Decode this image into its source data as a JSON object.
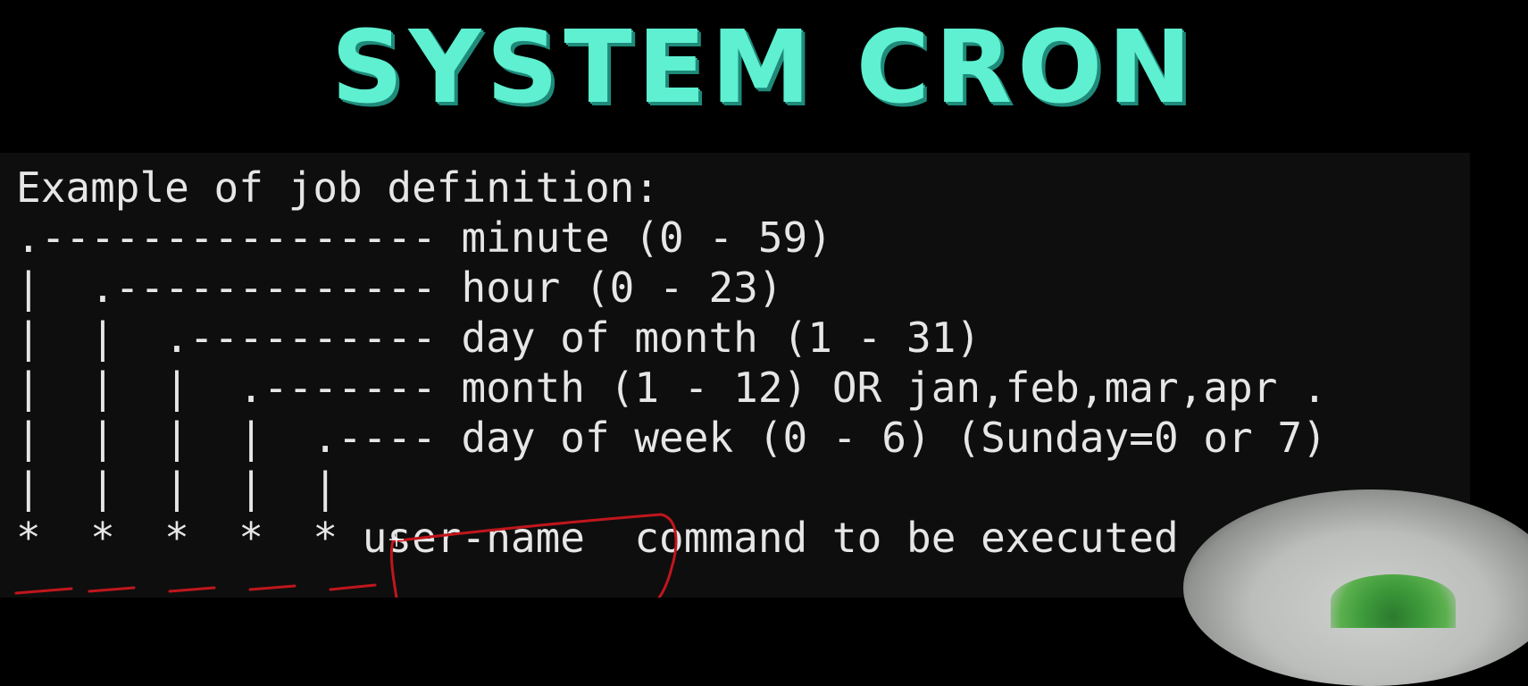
{
  "title": "SYSTEM CRON",
  "terminal": {
    "lines": [
      "Example of job definition:",
      ".---------------- minute (0 - 59)",
      "|  .------------- hour (0 - 23)",
      "|  |  .---------- day of month (1 - 31)",
      "|  |  |  .------- month (1 - 12) OR jan,feb,mar,apr .",
      "|  |  |  |  .---- day of week (0 - 6) (Sunday=0 or 7)",
      "|  |  |  |  |",
      "*  *  *  *  * user-name  command to be executed"
    ]
  },
  "colors": {
    "title": "#5ef0d0",
    "title_shadow": "#1f8a7a",
    "terminal_bg": "#0e0e0e",
    "terminal_text": "#e6e6e6",
    "annotation": "#c0161c"
  }
}
